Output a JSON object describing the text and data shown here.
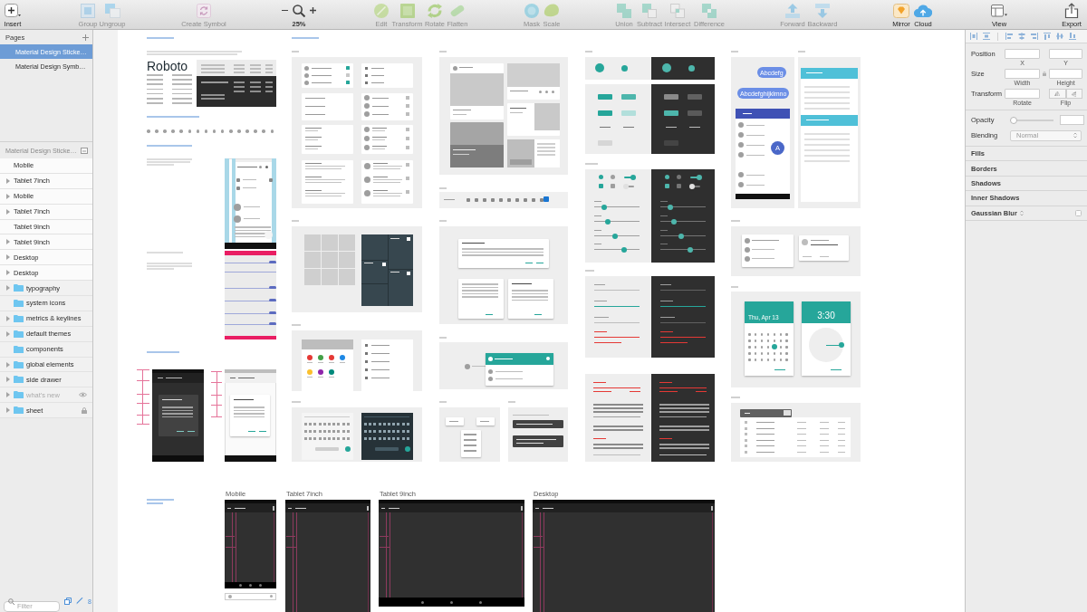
{
  "toolbar": {
    "items": [
      {
        "kind": "insert",
        "label": "Insert",
        "disabled": false
      },
      {
        "kind": "group",
        "label": "Group",
        "disabled": true
      },
      {
        "kind": "ungroup",
        "label": "Ungroup",
        "disabled": true
      },
      {
        "kind": "symbol",
        "label": "Create Symbol",
        "disabled": true
      },
      {
        "kind": "zoom",
        "label": "25%",
        "disabled": false
      },
      {
        "kind": "edit",
        "label": "Edit",
        "disabled": true
      },
      {
        "kind": "transform",
        "label": "Transform",
        "disabled": true
      },
      {
        "kind": "rotate",
        "label": "Rotate",
        "disabled": true
      },
      {
        "kind": "flatten",
        "label": "Flatten",
        "disabled": true
      },
      {
        "kind": "mask",
        "label": "Mask",
        "disabled": true
      },
      {
        "kind": "scale",
        "label": "Scale",
        "disabled": true
      },
      {
        "kind": "union",
        "label": "Union",
        "disabled": true
      },
      {
        "kind": "subtract",
        "label": "Subtract",
        "disabled": true
      },
      {
        "kind": "intersect",
        "label": "Intersect",
        "disabled": true
      },
      {
        "kind": "difference",
        "label": "Difference",
        "disabled": true
      },
      {
        "kind": "forward",
        "label": "Forward",
        "disabled": true
      },
      {
        "kind": "backward",
        "label": "Backward",
        "disabled": true
      },
      {
        "kind": "mirror",
        "label": "Mirror",
        "disabled": false
      },
      {
        "kind": "cloud",
        "label": "Cloud",
        "disabled": false
      },
      {
        "kind": "view",
        "label": "View",
        "disabled": false
      },
      {
        "kind": "export",
        "label": "Export",
        "disabled": false
      }
    ]
  },
  "sidebar": {
    "pages": {
      "title": "Pages",
      "items": [
        {
          "label": "Material Design Sticke…",
          "selected": true
        },
        {
          "label": "Material Design Symb…",
          "selected": false
        }
      ]
    },
    "layers": {
      "title": "Material Design Sticke…",
      "items": [
        {
          "label": "Mobile",
          "kind": "artboard",
          "expandable": false,
          "hidden": false,
          "locked": false
        },
        {
          "label": "Tablet 7inch",
          "kind": "artboard",
          "expandable": true,
          "hidden": false,
          "locked": false
        },
        {
          "label": "Mobile",
          "kind": "artboard",
          "expandable": true,
          "hidden": false,
          "locked": false
        },
        {
          "label": "Tablet 7inch",
          "kind": "artboard",
          "expandable": true,
          "hidden": false,
          "locked": false
        },
        {
          "label": "Tablet 9inch",
          "kind": "artboard",
          "expandable": false,
          "hidden": false,
          "locked": false
        },
        {
          "label": "Tablet 9inch",
          "kind": "artboard",
          "expandable": true,
          "hidden": false,
          "locked": false
        },
        {
          "label": "Desktop",
          "kind": "artboard",
          "expandable": true,
          "hidden": false,
          "locked": false
        },
        {
          "label": "Desktop",
          "kind": "artboard",
          "expandable": true,
          "hidden": false,
          "locked": false
        },
        {
          "label": "typography",
          "kind": "group",
          "expandable": true,
          "hidden": false,
          "locked": false
        },
        {
          "label": "system icons",
          "kind": "group",
          "expandable": false,
          "hidden": false,
          "locked": false
        },
        {
          "label": "metrics & keylines",
          "kind": "group",
          "expandable": true,
          "hidden": false,
          "locked": false
        },
        {
          "label": "default themes",
          "kind": "group",
          "expandable": true,
          "hidden": false,
          "locked": false
        },
        {
          "label": "components",
          "kind": "group",
          "expandable": false,
          "hidden": false,
          "locked": false
        },
        {
          "label": "global elements",
          "kind": "group",
          "expandable": true,
          "hidden": false,
          "locked": false
        },
        {
          "label": "side drawer",
          "kind": "group",
          "expandable": true,
          "hidden": false,
          "locked": false
        },
        {
          "label": "what's new",
          "kind": "group",
          "expandable": true,
          "hidden": true,
          "locked": false
        },
        {
          "label": "sheet",
          "kind": "group",
          "expandable": true,
          "hidden": false,
          "locked": true
        }
      ]
    },
    "filter": {
      "placeholder": "Filter"
    },
    "count": "8"
  },
  "inspector": {
    "position": {
      "label": "Position",
      "captions": [
        "X",
        "Y"
      ]
    },
    "size": {
      "label": "Size",
      "captions": [
        "Width",
        "Height"
      ]
    },
    "transform": {
      "label": "Transform",
      "captions": [
        "Rotate",
        "Flip"
      ]
    },
    "opacity": {
      "label": "Opacity",
      "level": 0
    },
    "blending": {
      "label": "Blending",
      "value": "Normal"
    },
    "sections": [
      {
        "kind": "plain",
        "label": "Fills"
      },
      {
        "kind": "plain",
        "label": "Borders"
      },
      {
        "kind": "plain",
        "label": "Shadows"
      },
      {
        "kind": "plain",
        "label": "Inner Shadows"
      },
      {
        "kind": "toggle",
        "label": "Gaussian Blur",
        "checked": false
      }
    ]
  },
  "canvas": {
    "type_sample": "Roboto",
    "chat_bubbles": [
      "Abcdefg",
      "Abcdefghijklmno"
    ],
    "avatar_letter": "A",
    "date": "Thu, Apr 13",
    "time": "3:30",
    "artboards": [
      {
        "title": "Mobile"
      },
      {
        "title": "Tablet 7inch"
      },
      {
        "title": "Tablet 9inch"
      },
      {
        "title": "Desktop"
      }
    ]
  }
}
